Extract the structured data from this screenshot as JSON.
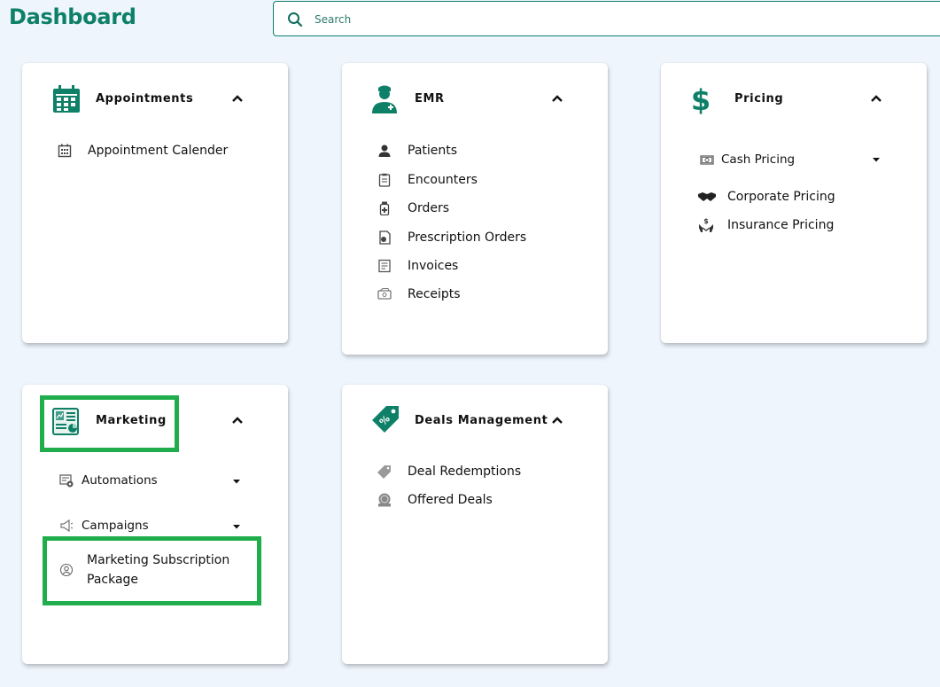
{
  "page": {
    "title": "Dashboard"
  },
  "search": {
    "placeholder": "Search",
    "value": ""
  },
  "colors": {
    "brand": "#0e8068",
    "highlight": "#1fae4b",
    "background": "#eef5fd"
  },
  "cards": {
    "appointments": {
      "title": "Appointments",
      "icon": "calendar-icon",
      "items": [
        {
          "label": "Appointment Calender",
          "icon": "calendar-small-icon"
        }
      ]
    },
    "emr": {
      "title": "EMR",
      "icon": "doctor-icon",
      "items": [
        {
          "label": "Patients",
          "icon": "patient-icon"
        },
        {
          "label": "Encounters",
          "icon": "clipboard-icon"
        },
        {
          "label": "Orders",
          "icon": "medicine-bottle-icon"
        },
        {
          "label": "Prescription Orders",
          "icon": "prescription-icon"
        },
        {
          "label": "Invoices",
          "icon": "invoice-icon"
        },
        {
          "label": "Receipts",
          "icon": "receipt-icon"
        }
      ]
    },
    "pricing": {
      "title": "Pricing",
      "icon": "dollar-icon",
      "items": [
        {
          "label": "Cash Pricing",
          "icon": "cash-icon",
          "expandable": true
        },
        {
          "label": "Corporate Pricing",
          "icon": "handshake-icon"
        },
        {
          "label": "Insurance Pricing",
          "icon": "insurance-hand-icon"
        }
      ]
    },
    "marketing": {
      "title": "Marketing",
      "icon": "marketing-report-icon",
      "items": [
        {
          "label": "Automations",
          "icon": "automation-icon",
          "expandable": true
        },
        {
          "label": "Campaigns",
          "icon": "megaphone-icon",
          "expandable": true
        },
        {
          "label": "Marketing Subscription Package",
          "icon": "user-circle-icon"
        }
      ]
    },
    "deals": {
      "title": "Deals Management",
      "icon": "deal-tag-icon",
      "items": [
        {
          "label": "Deal Redemptions",
          "icon": "tag-icon"
        },
        {
          "label": "Offered Deals",
          "icon": "deal-badge-icon"
        }
      ]
    }
  }
}
